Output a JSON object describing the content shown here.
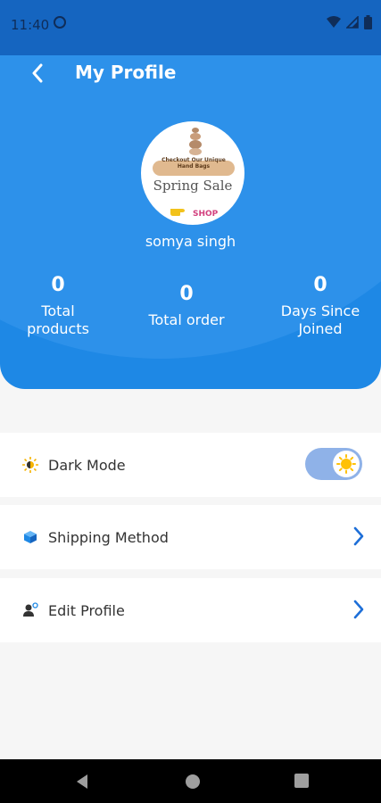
{
  "status_bar": {
    "time": "11:40",
    "background": "#1565c0"
  },
  "header": {
    "title": "My Profile",
    "background": "#1e88e5",
    "avatar": {
      "tag_text": "Checkout Our Unique Hand Bags",
      "headline": "Spring Sale",
      "cta": "SHOP"
    },
    "user_name": "somya singh",
    "stats": [
      {
        "value": "0",
        "label_line1": "Total",
        "label_line2": "products"
      },
      {
        "value": "0",
        "label_line1": "Total order",
        "label_line2": ""
      },
      {
        "value": "0",
        "label_line1": "Days Since",
        "label_line2": "Joined"
      }
    ]
  },
  "settings": {
    "dark_mode": {
      "label": "Dark Mode",
      "toggle_on": true
    },
    "shipping": {
      "label": "Shipping Method"
    },
    "edit_profile": {
      "label": "Edit Profile"
    }
  },
  "colors": {
    "accent": "#1e88e5",
    "chevron": "#1e6fd8",
    "toggle_track": "#8fb2e8"
  },
  "icons": {
    "back": "arrow-left-icon",
    "dark_mode": "sun-icon",
    "shipping": "box-icon",
    "edit_profile": "user-icon",
    "chevron": "chevron-right-icon"
  }
}
